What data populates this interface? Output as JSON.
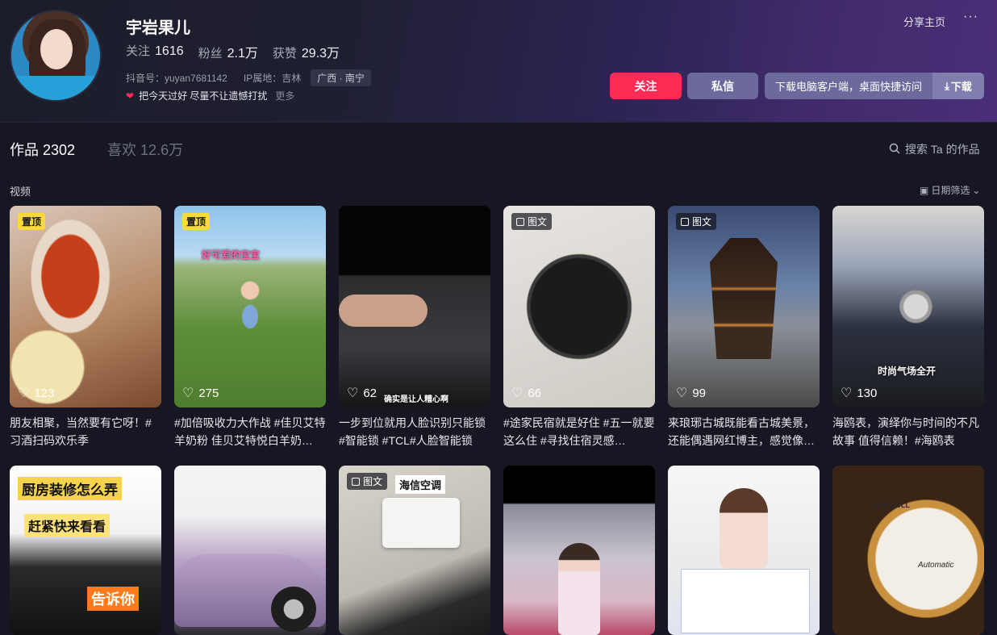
{
  "profile": {
    "nickname": "宇岩果儿",
    "following_label": "关注",
    "following_value": "1616",
    "followers_label": "粉丝",
    "followers_value": "2.1万",
    "likes_label": "获赞",
    "likes_value": "29.3万",
    "douyin_id": "抖音号：yuyan7681142",
    "ip_location": "IP属地：吉林",
    "region_tag": "广西 · 南宁",
    "bio": "把今天过好 尽量不让遗憾打扰",
    "bio_more": "更多"
  },
  "header_actions": {
    "share": "分享主页",
    "more": "···",
    "follow": "关注",
    "message": "私信",
    "download_client": "下载电脑客户端，桌面快捷访问",
    "download": "下载"
  },
  "tabs": {
    "works": "作品 2302",
    "liked": "喜欢 12.6万",
    "search": "搜索 Ta 的作品"
  },
  "section": {
    "label": "视频",
    "date_filter": "日期筛选"
  },
  "videos": [
    {
      "badge": "置顶",
      "badge_type": "pin",
      "likes": "123",
      "caption": "朋友相聚，当然要有它呀！#习酒扫码欢乐季"
    },
    {
      "badge": "置顶",
      "badge_type": "pin",
      "likes": "275",
      "caption": "#加倍吸收力大作战 #佳贝艾特羊奶粉 佳贝艾特悦白羊奶…",
      "overlay": "好可爱的宝宝"
    },
    {
      "badge": "",
      "badge_type": "none",
      "likes": "62",
      "caption": "一步到位就用人脸识别只能锁 #智能锁 #TCL#人脸智能锁",
      "overlay": "确实是让人糟心啊"
    },
    {
      "badge": "图文",
      "badge_type": "image",
      "likes": "66",
      "caption": "#途家民宿就是好住 #五一就要这么住 #寻找住宿灵感…"
    },
    {
      "badge": "图文",
      "badge_type": "image",
      "likes": "99",
      "caption": "来琅琊古城既能看古城美景，还能偶遇网红博主，感觉像…"
    },
    {
      "badge": "",
      "badge_type": "none",
      "likes": "130",
      "caption": "海鸥表，演绎你与时间的不凡故事 值得信赖！#海鸥表",
      "overlay": "时尚气场全开"
    },
    {
      "badge": "",
      "badge_type": "none",
      "likes": "",
      "caption": "",
      "overlay": "厨房装修怎么弄",
      "overlay2": "赶紧快来看看",
      "overlay3": "告诉你"
    },
    {
      "badge": "",
      "badge_type": "none",
      "likes": "",
      "caption": ""
    },
    {
      "badge": "图文",
      "badge_type": "image",
      "likes": "",
      "caption": "",
      "overlay": "海信空调"
    },
    {
      "badge": "",
      "badge_type": "none",
      "likes": "",
      "caption": ""
    },
    {
      "badge": "",
      "badge_type": "none",
      "likes": "",
      "caption": ""
    },
    {
      "badge": "",
      "badge_type": "none",
      "likes": "",
      "caption": "",
      "overlay": "SEA-GULL",
      "overlay2": "Automatic"
    }
  ]
}
